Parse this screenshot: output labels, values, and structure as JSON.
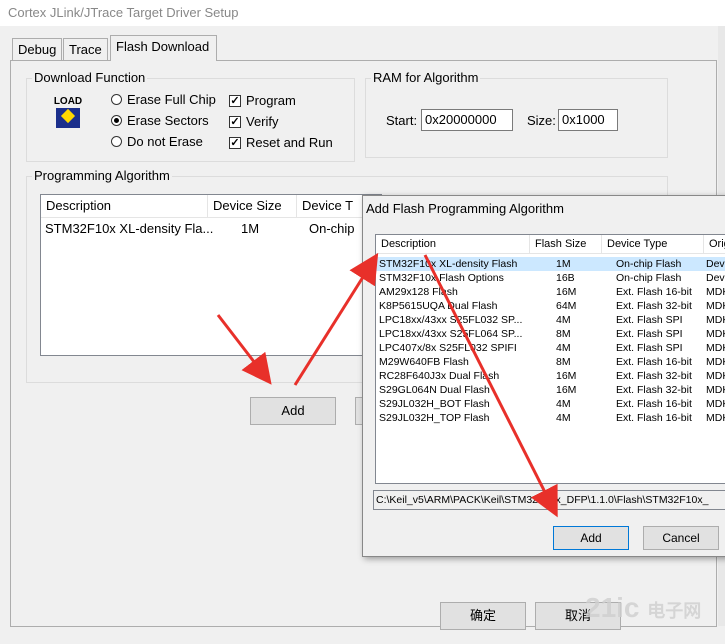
{
  "window": {
    "title": "Cortex JLink/JTrace Target Driver Setup"
  },
  "tabs": [
    {
      "label": "Debug"
    },
    {
      "label": "Trace"
    },
    {
      "label": "Flash Download"
    }
  ],
  "download_function": {
    "legend": "Download Function",
    "load_icon_text": "LOAD",
    "radios": [
      {
        "label": "Erase Full Chip",
        "selected": false
      },
      {
        "label": "Erase Sectors",
        "selected": true
      },
      {
        "label": "Do not Erase",
        "selected": false
      }
    ],
    "checkboxes": [
      {
        "label": "Program",
        "checked": true
      },
      {
        "label": "Verify",
        "checked": true
      },
      {
        "label": "Reset and Run",
        "checked": true
      }
    ]
  },
  "ram": {
    "legend": "RAM for Algorithm",
    "start_label": "Start:",
    "start_value": "0x20000000",
    "size_label": "Size:",
    "size_value": "0x1000"
  },
  "programming": {
    "legend": "Programming Algorithm",
    "headers": [
      "Description",
      "Device Size",
      "Device T"
    ],
    "rows": [
      {
        "description": "STM32F10x XL-density Fla...",
        "size": "1M",
        "type": "On-chip"
      }
    ],
    "add_label": "Add"
  },
  "dialog": {
    "title": "Add Flash Programming Algorithm",
    "headers": [
      "Description",
      "Flash Size",
      "Device Type",
      "Origi"
    ],
    "rows": [
      {
        "description": "STM32F10x XL-density Flash",
        "size": "1M",
        "type": "On-chip Flash",
        "origin": "Devi"
      },
      {
        "description": "STM32F10x Flash Options",
        "size": "16B",
        "type": "On-chip Flash",
        "origin": "Devi"
      },
      {
        "description": "AM29x128 Flash",
        "size": "16M",
        "type": "Ext. Flash 16-bit",
        "origin": "MDK"
      },
      {
        "description": "K8P5615UQA Dual Flash",
        "size": "64M",
        "type": "Ext. Flash 32-bit",
        "origin": "MDK"
      },
      {
        "description": "LPC18xx/43xx S25FL032 SP...",
        "size": "4M",
        "type": "Ext. Flash SPI",
        "origin": "MDK"
      },
      {
        "description": "LPC18xx/43xx S25FL064 SP...",
        "size": "8M",
        "type": "Ext. Flash SPI",
        "origin": "MDK"
      },
      {
        "description": "LPC407x/8x S25FL032 SPIFI",
        "size": "4M",
        "type": "Ext. Flash SPI",
        "origin": "MDK"
      },
      {
        "description": "M29W640FB Flash",
        "size": "8M",
        "type": "Ext. Flash 16-bit",
        "origin": "MDK"
      },
      {
        "description": "RC28F640J3x Dual Flash",
        "size": "16M",
        "type": "Ext. Flash 32-bit",
        "origin": "MDK"
      },
      {
        "description": "S29GL064N Dual Flash",
        "size": "16M",
        "type": "Ext. Flash 32-bit",
        "origin": "MDK"
      },
      {
        "description": "S29JL032H_BOT Flash",
        "size": "4M",
        "type": "Ext. Flash 16-bit",
        "origin": "MDK"
      },
      {
        "description": "S29JL032H_TOP Flash",
        "size": "4M",
        "type": "Ext. Flash 16-bit",
        "origin": "MDK"
      }
    ],
    "path": "C:\\Keil_v5\\ARM\\PACK\\Keil\\STM32F1xx_DFP\\1.1.0\\Flash\\STM32F10x_",
    "add_label": "Add",
    "cancel_label": "Cancel"
  },
  "footer": {
    "ok_label": "确定",
    "cancel_label": "取消"
  },
  "watermark": {
    "brand": "21ic",
    "cn": "电子网"
  },
  "colors": {
    "arrow": "#e8302a",
    "selection": "#cce8ff",
    "focus": "#0078d7"
  }
}
